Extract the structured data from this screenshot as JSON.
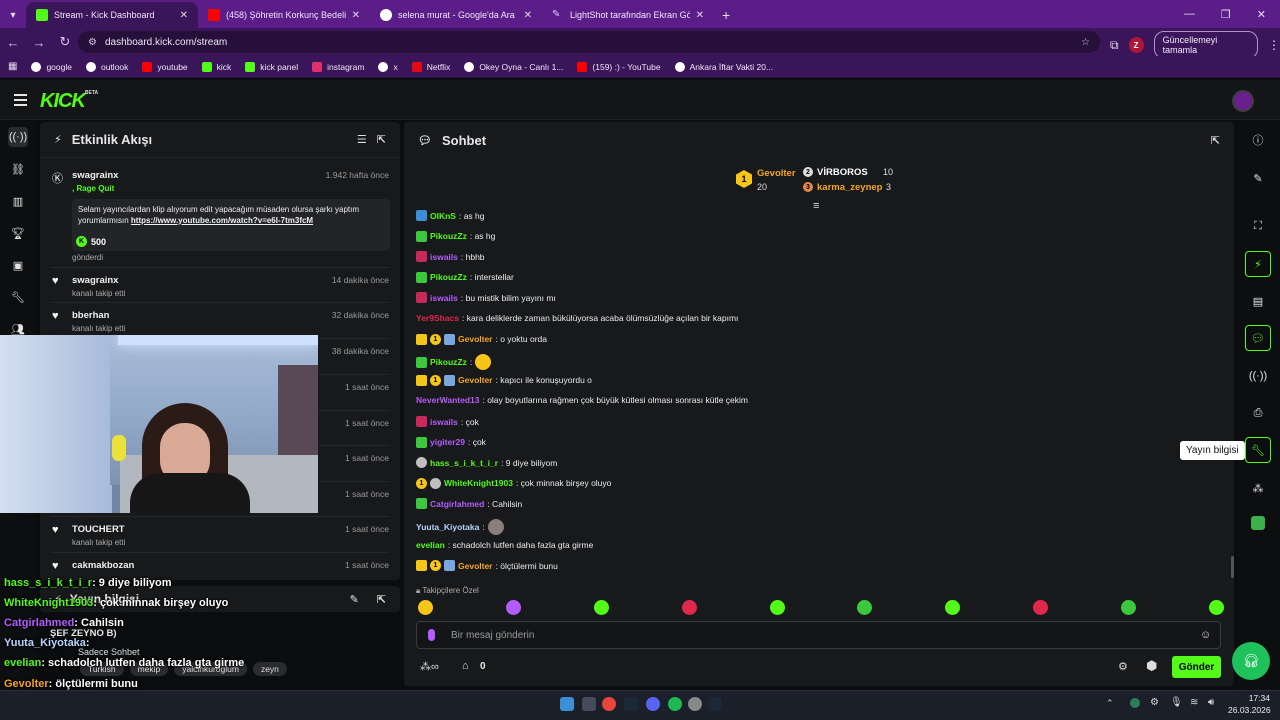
{
  "browser": {
    "tabs": [
      {
        "label": "Stream - Kick Dashboard",
        "color": "#53fc18"
      },
      {
        "label": "(458) Şöhretin Korkunç Bedeli:",
        "color": "#ff0000"
      },
      {
        "label": "selena murat - Google'da Ara",
        "color": "#ffffff"
      },
      {
        "label": "LightShot tarafından Ekran Gör",
        "color": "#b388ff"
      }
    ],
    "url": "dashboard.kick.com/stream",
    "profile_initial": "Z",
    "update_label": "Güncellemeyi tamamla",
    "bookmarks": [
      {
        "label": "google",
        "color": "#ffffff"
      },
      {
        "label": "outlook",
        "color": "#ffffff"
      },
      {
        "label": "youtube",
        "color": "#ff0000"
      },
      {
        "label": "kick",
        "color": "#53fc18"
      },
      {
        "label": "kick panel",
        "color": "#53fc18"
      },
      {
        "label": "instagram",
        "color": "#e1306c"
      },
      {
        "label": "x",
        "color": "#ffffff"
      },
      {
        "label": "Netflix",
        "color": "#e50914"
      },
      {
        "label": "Okey Oyna - Canlı 1...",
        "color": "#ffffff"
      },
      {
        "label": "(159) :) - YouTube",
        "color": "#ff0000"
      },
      {
        "label": "Ankara İftar Vakti 20...",
        "color": "#ffffff"
      }
    ]
  },
  "kick": {
    "logo": "KICK",
    "logo_sup": "BETA",
    "accent": "#53fc18"
  },
  "activity": {
    "title": "Etkinlik Akışı",
    "events": [
      {
        "user": "swagrainx",
        "time": "1.942 hafta önce",
        "sub": ""
      },
      {
        "user": "swagrainx",
        "time": "14 dakika önce",
        "sub": "kanalı takip etti"
      },
      {
        "user": "bberhan",
        "time": "32 dakika önce",
        "sub": "kanalı takip etti"
      },
      {
        "user": "",
        "time": "38 dakika önce",
        "sub": ""
      },
      {
        "user": "",
        "time": "1 saat önce",
        "sub": ""
      },
      {
        "user": "",
        "time": "1 saat önce",
        "sub": ""
      },
      {
        "user": "",
        "time": "1 saat önce",
        "sub": ""
      },
      {
        "user": "",
        "time": "1 saat önce",
        "sub": ""
      },
      {
        "user": "TOUCHERT",
        "time": "1 saat önce",
        "sub": "kanalı takip etti"
      },
      {
        "user": "cakmakbozan",
        "time": "1 saat önce",
        "sub": ""
      }
    ],
    "rage_quit": ", Rage Quit",
    "message": "Selam yayıncılardan klip alıyorum edit yapacağım müsaden olursa şarkı yaptım yorumlarmısın",
    "link": "https://www.youtube.com/watch?v=e6I-7tm3fcM",
    "kicks": "500",
    "sent": "gönderdi"
  },
  "stream_info": {
    "title": "Yayın bilgisi",
    "stream_title": "ŞEF ZEYNO B)",
    "category": "Sadece Sohbet",
    "tags": [
      "Turkish",
      "mekip",
      "yalcinkuroglum",
      "zeyn"
    ]
  },
  "overlay_chat": [
    {
      "user": "hass_s_i_k_t_i_r",
      "text": ": 9 diye biliyom",
      "color": "#53fc18"
    },
    {
      "user": "WhiteKnight1903",
      "text": ": çok minnak birşey oluyo",
      "color": "#53fc18"
    },
    {
      "user": "Catgirlahmed",
      "text": ": Cahilsin",
      "color": "#b45cff"
    },
    {
      "user": "Yuuta_Kiyotaka",
      "text": ":",
      "color": "#b7d4ff"
    },
    {
      "user": "evelian",
      "text": ": schadolch lutfen daha fazla gta girme",
      "color": "#53fc18"
    },
    {
      "user": "Gevolter",
      "text": ": ölçtülermi bunu",
      "color": "#f5a623"
    }
  ],
  "chat": {
    "title": "Sohbet",
    "podium": [
      {
        "rank": "1",
        "user": "Gevolter",
        "count": "20",
        "color": "#f5a623"
      },
      {
        "rank": "2",
        "user": "VİRBOROS",
        "count": "10",
        "color": "#ffffff"
      },
      {
        "rank": "3",
        "user": "karma_zeynep",
        "count": "3",
        "color": "#f5a623"
      }
    ],
    "messages": [
      {
        "user": "OlKnS",
        "text": ": as hg",
        "color": "#53fc18",
        "badges": [
          "blue"
        ]
      },
      {
        "user": "PikouzZz",
        "text": ": as hg",
        "color": "#53fc18",
        "badges": [
          "green"
        ]
      },
      {
        "user": "iswails",
        "text": ": hbhb",
        "color": "#b45cff",
        "badges": [
          "red"
        ]
      },
      {
        "user": "PikouzZz",
        "text": ": interstellar",
        "color": "#53fc18",
        "badges": [
          "green"
        ]
      },
      {
        "user": "iswails",
        "text": ": bu mistik bilim yayını mı",
        "color": "#b45cff",
        "badges": [
          "red"
        ]
      },
      {
        "user": "Yer9Shacs",
        "text": ": kara deliklerde zaman bükülüyorsa acaba ölümsüzlüğe açılan bir kapımı",
        "color": "#e0284d",
        "badges": []
      },
      {
        "user": "Gevolter",
        "text": ": o yoktu orda",
        "color": "#f5a623",
        "badges": [
          "crown",
          "one",
          "gift"
        ]
      },
      {
        "user": "PikouzZz",
        "text": ":",
        "color": "#53fc18",
        "badges": [
          "green"
        ],
        "emote": "#f5c518"
      },
      {
        "user": "Gevolter",
        "text": ": kapıcı ile konuşuyordu o",
        "color": "#f5a623",
        "badges": [
          "crown",
          "one",
          "gift"
        ]
      },
      {
        "user": "NeverWanted13",
        "text": ": olay boyutlarına rağmen çok büyük kütlesi olması sonrası kütle çekim",
        "color": "#b45cff",
        "badges": []
      },
      {
        "user": "iswails",
        "text": ": çok",
        "color": "#b45cff",
        "badges": [
          "red"
        ]
      },
      {
        "user": "yigiter29",
        "text": ": çok",
        "color": "#b45cff",
        "badges": [
          "green"
        ]
      },
      {
        "user": "hass_s_i_k_t_i_r",
        "text": ": 9 diye biliyom",
        "color": "#53fc18",
        "badges": [
          "wolf"
        ]
      },
      {
        "user": "WhiteKnight1903",
        "text": ": çok minnak birşey oluyo",
        "color": "#53fc18",
        "badges": [
          "one",
          "wolf"
        ]
      },
      {
        "user": "Catgirlahmed",
        "text": ": Cahilsin",
        "color": "#b45cff",
        "badges": [
          "green"
        ]
      },
      {
        "user": "Yuuta_Kiyotaka",
        "text": ":",
        "color": "#b7d4ff",
        "badges": [],
        "emote": "#8a7f7a"
      },
      {
        "user": "evelian",
        "text": ": schadolch lutfen daha fazla gta girme",
        "color": "#53fc18",
        "badges": []
      },
      {
        "user": "Gevolter",
        "text": ": ölçtülermi bunu",
        "color": "#f5a623",
        "badges": [
          "crown",
          "one",
          "gift"
        ]
      }
    ],
    "followers_only": "Takipçilere Özel",
    "emote_colors": [
      "#f5c518",
      "#b45cff",
      "#53fc18",
      "#e0284d",
      "#53fc18",
      "#3cc83c",
      "#53fc18",
      "#e0284d",
      "#3cc83c",
      "#53fc18"
    ],
    "input_placeholder": "Bir mesaj gönderin",
    "points": "0",
    "send_label": "Gönder"
  },
  "tooltip": "Yayın bilgisi",
  "taskbar": {
    "time": "17:34",
    "date": "26.03.2026"
  }
}
